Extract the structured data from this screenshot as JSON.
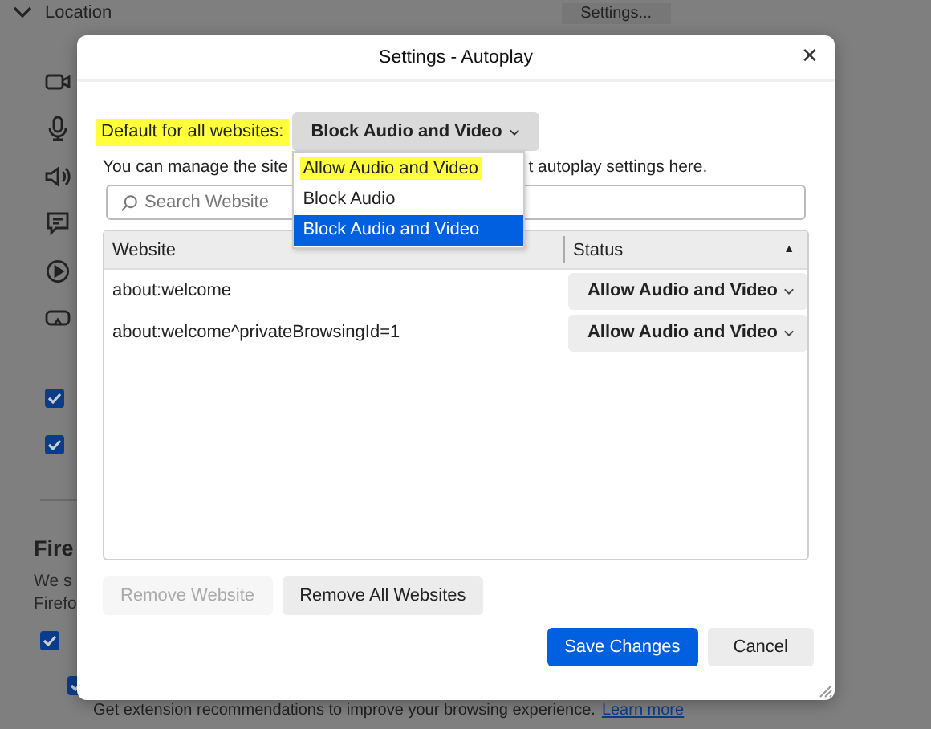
{
  "background": {
    "location_label": "Location",
    "settings_button": "Settings...",
    "permissions": [
      {
        "kind": "camera"
      },
      {
        "kind": "mic"
      },
      {
        "kind": "speaker"
      },
      {
        "kind": "message"
      },
      {
        "kind": "autoplay"
      },
      {
        "kind": "vr"
      }
    ],
    "checkboxes": [
      {
        "checked": true
      },
      {
        "checked": true
      }
    ],
    "section_title": "Fire",
    "section_text": [
      "We s",
      "Firefo"
    ],
    "section_checkbox": {
      "checked": true
    },
    "sub_checkbox": {
      "checked": true
    },
    "sub_text": "Get extension recommendations to improve your browsing experience.",
    "learn_more": "Learn more"
  },
  "dialog": {
    "title": "Settings - Autoplay",
    "close": "✕",
    "default_label": {
      "text": "Default for all websites:",
      "highlighted": true
    },
    "default_dropdown": {
      "value": "Block Audio and Video",
      "expanded": true,
      "options": [
        {
          "label": "Allow Audio and Video",
          "highlighted": true,
          "selected": false
        },
        {
          "label": "Block Audio",
          "highlighted": false,
          "selected": false
        },
        {
          "label": "Block Audio and Video",
          "highlighted": false,
          "selected": true
        }
      ]
    },
    "description": [
      "You can manage the site",
      "t autoplay settings here."
    ],
    "search": {
      "placeholder": "Search Website"
    },
    "table": {
      "columns": [
        {
          "label": "Website"
        },
        {
          "label": "Status",
          "sort": "▲"
        }
      ],
      "rows": [
        {
          "website": "about:welcome",
          "status": "Allow Audio and Video"
        },
        {
          "website": "about:welcome^privateBrowsingId=1",
          "status": "Allow Audio and Video"
        }
      ]
    },
    "buttons": [
      {
        "label": "Remove Website",
        "disabled": true
      },
      {
        "label": "Remove All Websites",
        "disabled": false
      }
    ],
    "footer_buttons": [
      {
        "label": "Save Changes",
        "primary": true
      },
      {
        "label": "Cancel",
        "primary": false
      }
    ]
  }
}
